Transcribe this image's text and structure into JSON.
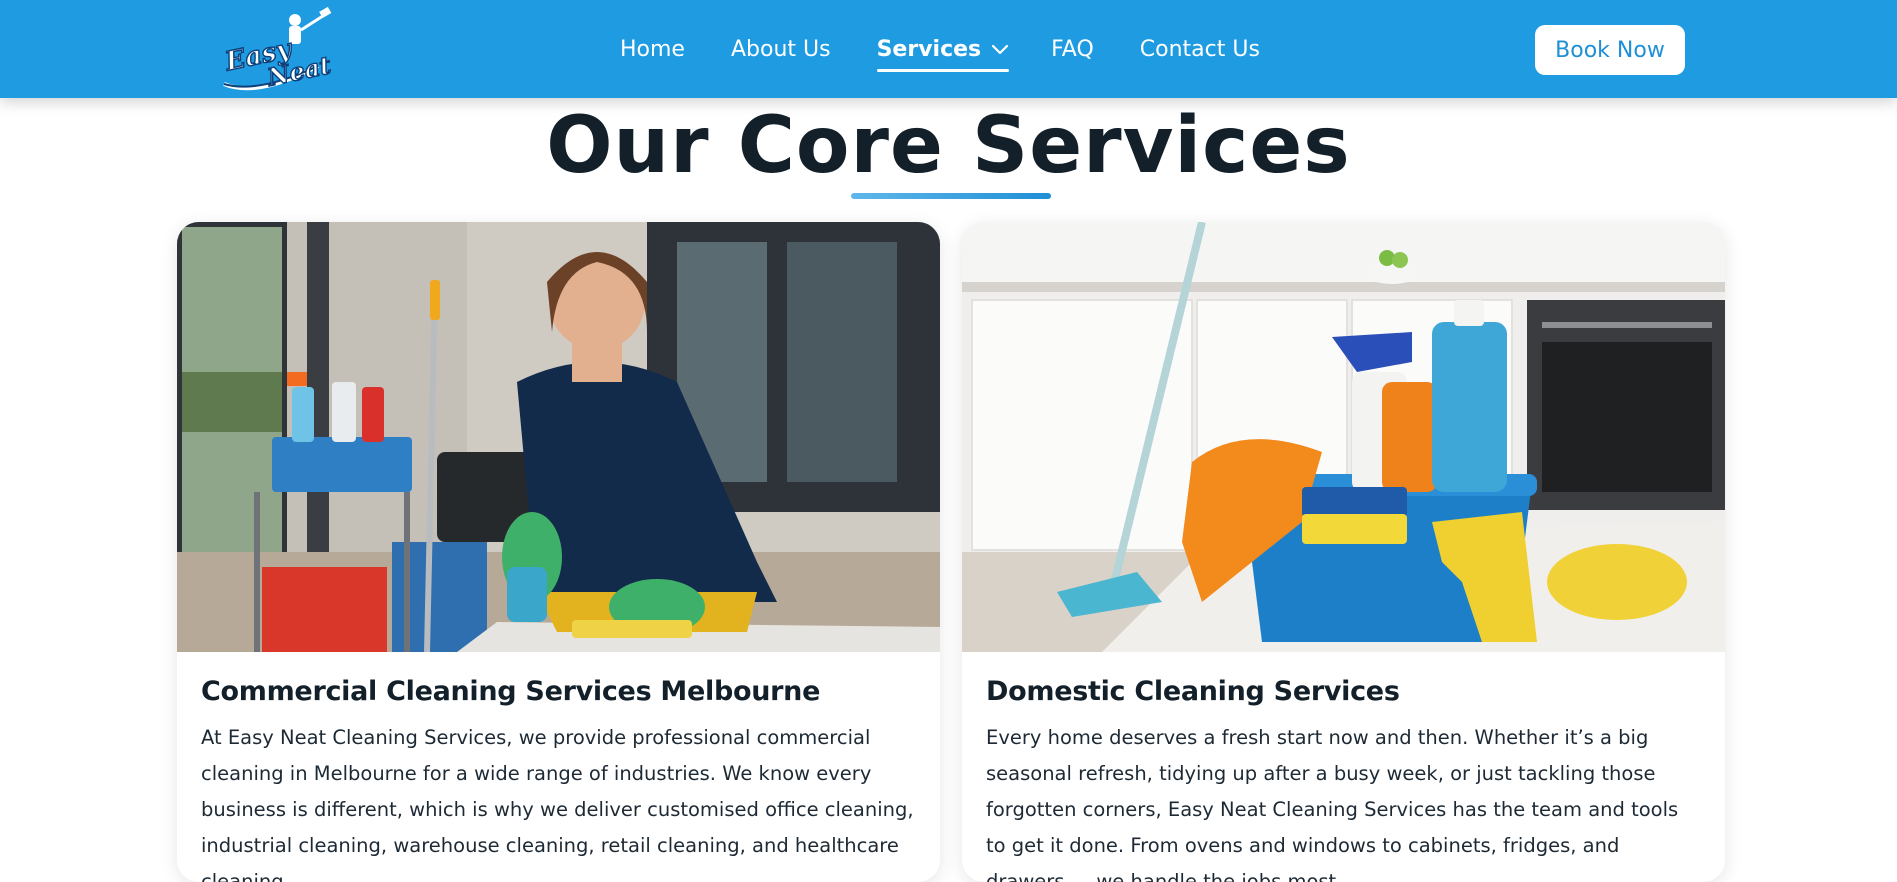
{
  "header": {
    "logo_text_1": "Easy",
    "logo_text_2": "Neat",
    "nav": [
      {
        "label": "Home"
      },
      {
        "label": "About Us"
      },
      {
        "label": "Services"
      },
      {
        "label": "FAQ"
      },
      {
        "label": "Contact Us"
      }
    ],
    "active_nav": "Services",
    "book_label": "Book Now"
  },
  "section": {
    "title": "Our Core Services"
  },
  "cards": [
    {
      "title": "Commercial Cleaning Services Melbourne",
      "text": "At Easy Neat Cleaning Services, we provide professional commercial cleaning in Melbourne for a wide range of industries. We know every business is different, which is why we deliver customised office cleaning, industrial cleaning, warehouse cleaning, retail cleaning, and healthcare cleaning",
      "image": "cleaner-in-office-photo"
    },
    {
      "title": "Domestic Cleaning Services",
      "text": "Every home deserves a fresh start now and then. Whether it’s a big seasonal refresh, tidying up after a busy week, or just tackling those forgotten corners, Easy Neat Cleaning Services has the team and tools to get it done. From ovens and windows to cabinets, fridges, and drawers — we handle the jobs most",
      "image": "cleaning-supplies-kitchen-photo"
    }
  ],
  "colors": {
    "header": "#1f9be2",
    "accent": "#1f8fd6",
    "title": "#13202a"
  }
}
